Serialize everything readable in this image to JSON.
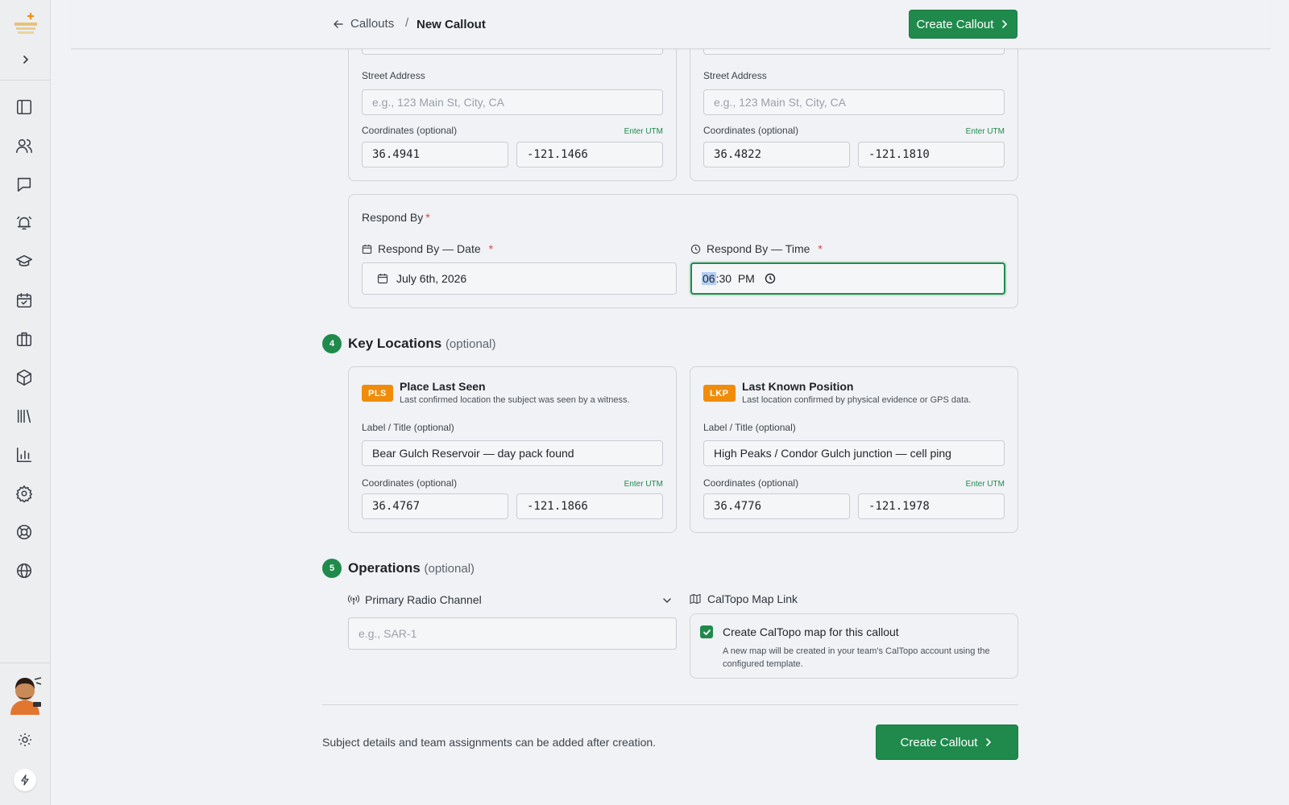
{
  "header": {
    "back_label": "Callouts",
    "separator": "/",
    "current": "New Callout",
    "create_label": "Create Callout"
  },
  "locations_top": {
    "left": {
      "street_label": "Street Address",
      "street_placeholder": "e.g., 123 Main St, City, CA",
      "coords_label": "Coordinates (optional)",
      "utm_label": "Enter UTM",
      "lat": "36.4941",
      "lon": "-121.1466"
    },
    "right": {
      "street_label": "Street Address",
      "street_placeholder": "e.g., 123 Main St, City, CA",
      "coords_label": "Coordinates (optional)",
      "utm_label": "Enter UTM",
      "lat": "36.4822",
      "lon": "-121.1810"
    }
  },
  "respond_by": {
    "title": "Respond By",
    "required": "*",
    "date_label": "Respond By — Date",
    "date_value": "July 6th, 2026",
    "time_label": "Respond By — Time",
    "time_hour": "06",
    "time_rest": ":30  PM"
  },
  "key_locations": {
    "step": "4",
    "title": "Key Locations",
    "optional": "(optional)",
    "pls": {
      "tag": "PLS",
      "title": "Place Last Seen",
      "subtitle": "Last confirmed location the subject was seen by a witness.",
      "label_label": "Label / Title (optional)",
      "label_value": "Bear Gulch Reservoir — day pack found",
      "coords_label": "Coordinates (optional)",
      "utm_label": "Enter UTM",
      "lat": "36.4767",
      "lon": "-121.1866"
    },
    "lkp": {
      "tag": "LKP",
      "title": "Last Known Position",
      "subtitle": "Last location confirmed by physical evidence or GPS data.",
      "label_label": "Label / Title (optional)",
      "label_value": "High Peaks / Condor Gulch junction — cell ping",
      "coords_label": "Coordinates (optional)",
      "utm_label": "Enter UTM",
      "lat": "36.4776",
      "lon": "-121.1978"
    }
  },
  "operations": {
    "step": "5",
    "title": "Operations",
    "optional": "(optional)",
    "radio_label": "Primary Radio Channel",
    "radio_placeholder": "e.g., SAR-1",
    "caltopo_label": "CalTopo Map Link",
    "caltopo_check_label": "Create CalTopo map for this callout",
    "caltopo_check_desc": "A new map will be created in your team's CalTopo account using the configured template.",
    "caltopo_checked": true
  },
  "footer": {
    "note": "Subject details and team assignments can be added after creation.",
    "create_label": "Create Callout"
  },
  "colors": {
    "accent": "#1f8a4c",
    "tag": "#f08c0a",
    "required": "#e0413a"
  },
  "sidebar_icons": [
    "panel-icon",
    "users-icon",
    "chat-icon",
    "alarm-icon",
    "graduation-cap-icon",
    "calendar-check-icon",
    "briefcase-icon",
    "package-icon",
    "library-icon",
    "bar-chart-icon",
    "gear-icon",
    "lifebuoy-icon",
    "globe-icon"
  ]
}
